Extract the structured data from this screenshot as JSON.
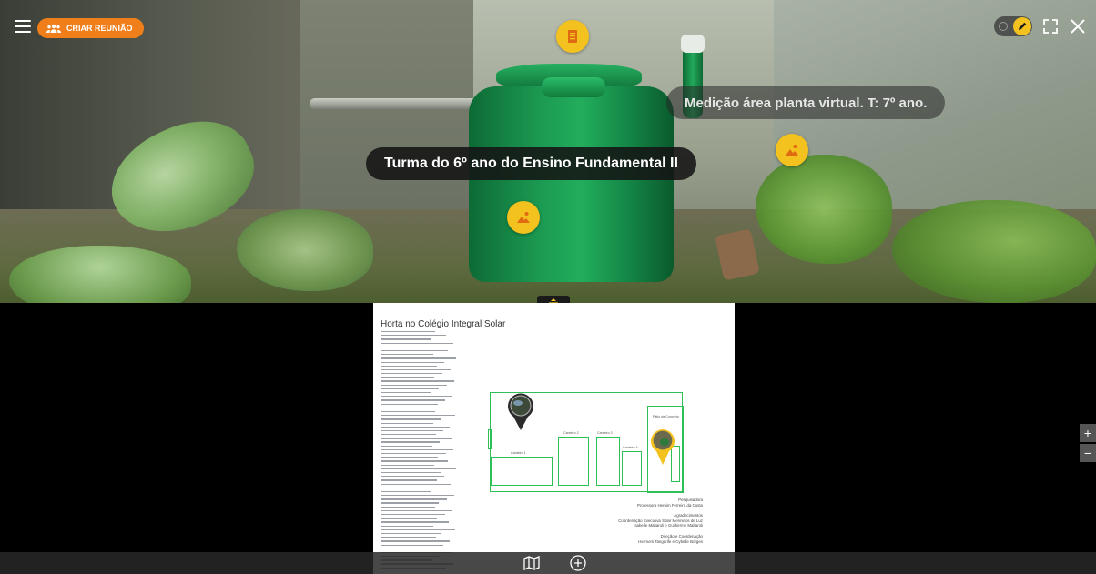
{
  "toolbar": {
    "meeting_label": "CRIAR REUNIÃO"
  },
  "hotspots": {
    "label_turma": "Turma do 6º ano do Ensino Fundamental II",
    "label_medicao": "Medição área planta virtual. T: 7º ano."
  },
  "document": {
    "title": "Horta no Colégio Integral Solar",
    "credits": {
      "role1": "Pesquisadora",
      "name1": "Professora Heroim Ferreira da Costa",
      "role2": "Agradecimentos",
      "name2a": "Coordenação Executiva Solar Menninos de Luz",
      "name2b": "Isabelle Maltaroli e Guilherme Maltaroli",
      "role3": "Direção e Coordenação",
      "name3": "Hermom Tangarife e Cybelle Borges"
    },
    "plan_labels": {
      "canteiro1": "Canteiro 1",
      "canteiro2": "Canteiro 2",
      "canteiro3": "Canteiro 3",
      "canteiro4": "Canteiro 4",
      "patio": "Pátio de Concreto"
    }
  },
  "zoom": {
    "in_label": "+",
    "out_label": "−"
  },
  "colors": {
    "accent_orange": "#f07e1a",
    "hotspot_yellow": "#f4c21f",
    "plan_green": "#2fbf57"
  }
}
